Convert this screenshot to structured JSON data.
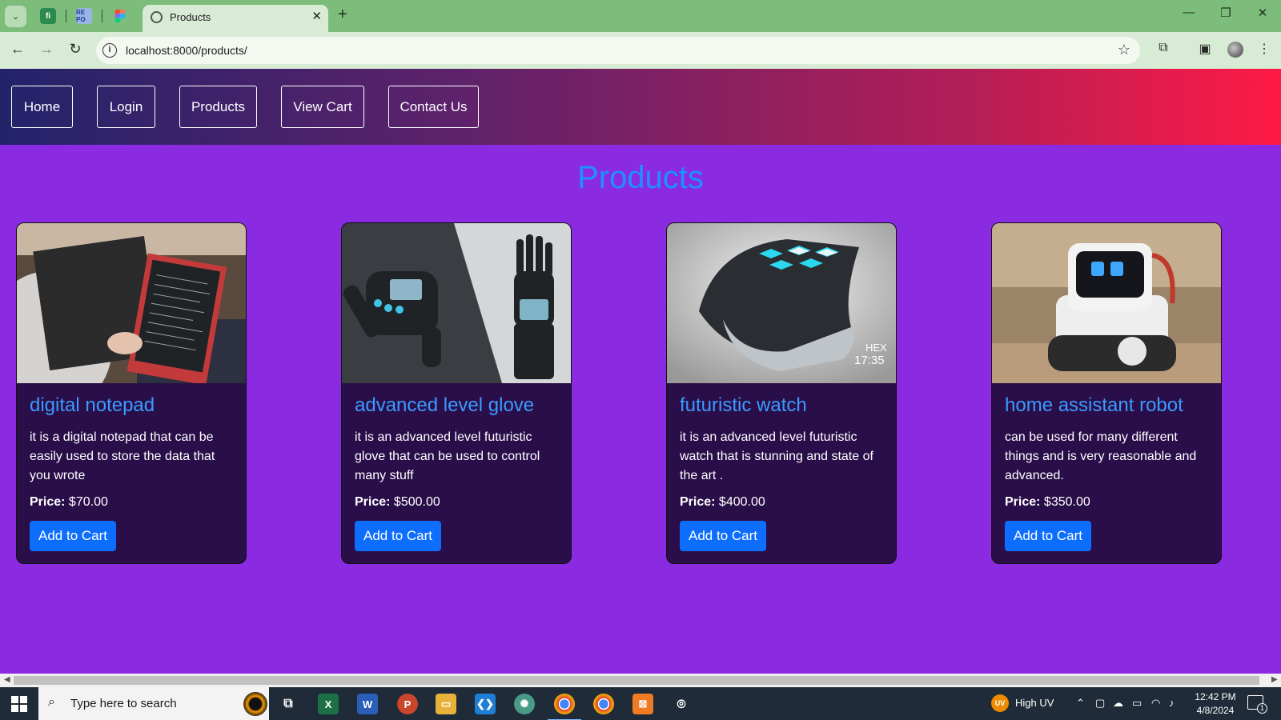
{
  "browser": {
    "tab_title": "Products",
    "url": "localhost:8000/products/",
    "pinned_tabs": [
      "fi",
      "RE PO",
      ""
    ]
  },
  "nav": {
    "links": [
      "Home",
      "Login",
      "Products",
      "View Cart",
      "Contact Us"
    ]
  },
  "page": {
    "heading": "Products"
  },
  "products": [
    {
      "name": "digital notepad",
      "description": "it is a digital notepad that can be easily used to store the data that you wrote",
      "price_label": "Price:",
      "price": "$70.00",
      "button": "Add to Cart",
      "image": "digital-notepad-photo"
    },
    {
      "name": "advanced level glove",
      "description": "it is an advanced level futuristic glove that can be used to control many stuff",
      "price_label": "Price:",
      "price": "$500.00",
      "button": "Add to Cart",
      "image": "futuristic-glove-photo"
    },
    {
      "name": "futuristic watch",
      "description": "it is an advanced level futuristic watch that is stunning and state of the art .",
      "price_label": "Price:",
      "price": "$400.00",
      "button": "Add to Cart",
      "image": "futuristic-watch-photo",
      "image_text": [
        "HEX",
        "17:35"
      ]
    },
    {
      "name": "home assistant robot",
      "description": "can be used for many different things and is very reasonable and advanced.",
      "price_label": "Price:",
      "price": "$350.00",
      "button": "Add to Cart",
      "image": "robot-photo"
    }
  ],
  "taskbar": {
    "search_placeholder": "Type here to search",
    "weather_badge": "UV",
    "weather_text": "High UV",
    "time": "12:42 PM",
    "date": "4/8/2024",
    "notification_count": "1"
  },
  "colors": {
    "page_bg": "#8a2be2",
    "card_bg": "#2a0e4a",
    "heading": "#1e90ff",
    "button": "#0d6efd",
    "tabstrip": "#7cbd7c"
  }
}
